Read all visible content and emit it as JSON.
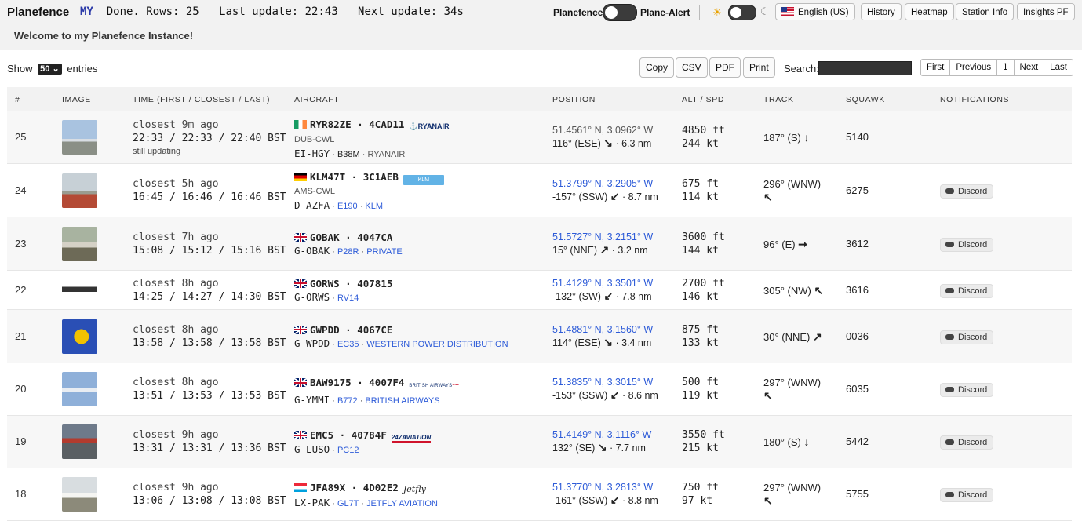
{
  "header": {
    "brand": "Planefence",
    "my": "MY",
    "status": "Done. Rows: 25",
    "last_update": "Last update: 22:43",
    "next_update": "Next update: 34s",
    "welcome": "Welcome to my Planefence Instance!",
    "toggle_left": "Planefence",
    "toggle_right": "Plane-Alert",
    "language": "English (US)",
    "buttons": [
      "History",
      "Heatmap",
      "Station Info",
      "Insights PF"
    ]
  },
  "controls": {
    "show_prefix": "Show",
    "entries_value": "50",
    "show_suffix": "entries",
    "export_buttons": [
      "Copy",
      "CSV",
      "PDF",
      "Print"
    ],
    "search_label": "Search:",
    "pager": [
      "First",
      "Previous",
      "1",
      "Next",
      "Last"
    ]
  },
  "table": {
    "columns": [
      "#",
      "Image",
      "Time (First / Closest / Last)",
      "Aircraft",
      "Position",
      "Alt / Spd",
      "Track",
      "Squawk",
      "Notifications"
    ],
    "rows": [
      {
        "num": "25",
        "closest": "closest 9m ago",
        "times": "22:33 / 22:33 / 22:40 BST",
        "note": "still updating",
        "flag": "ie",
        "callsign": "RYR82ZE",
        "hex": "4CAD11",
        "logo": "RYANAIR",
        "route": "DUB-CWL",
        "reg": "EI-HGY",
        "type": "B38M",
        "operator": "RYANAIR",
        "coords": "51.4561° N, 3.0962° W",
        "bearing": "116° (ESE)",
        "arrow": "↘",
        "dist": "6.3 nm",
        "alt": "4850 ft",
        "spd": "244 kt",
        "track": "187° (S)",
        "track_arrow": "↓",
        "squawk": "5140",
        "notify": ""
      },
      {
        "num": "24",
        "closest": "closest 5h ago",
        "times": "16:45 / 16:46 / 16:46 BST",
        "note": "",
        "flag": "de",
        "callsign": "KLM47T",
        "hex": "3C1AEB",
        "logo": "KLM",
        "route": "AMS-CWL",
        "reg": "D-AZFA",
        "type": "E190",
        "operator": "KLM",
        "coords": "51.3799° N, 3.2905° W",
        "bearing": "-157° (SSW)",
        "arrow": "↙",
        "dist": "8.7 nm",
        "alt": "675 ft",
        "spd": "114 kt",
        "track": "296° (WNW)",
        "track_arrow": "↖",
        "squawk": "6275",
        "notify": "Discord"
      },
      {
        "num": "23",
        "closest": "closest 7h ago",
        "times": "15:08 / 15:12 / 15:16 BST",
        "note": "",
        "flag": "gb",
        "callsign": "GOBAK",
        "hex": "4047CA",
        "logo": "",
        "route": "",
        "reg": "G-OBAK",
        "type": "P28R",
        "operator": "PRIVATE",
        "coords": "51.5727° N, 3.2151° W",
        "bearing": "15° (NNE)",
        "arrow": "↗",
        "dist": "3.2 nm",
        "alt": "3600 ft",
        "spd": "144 kt",
        "track": "96° (E)",
        "track_arrow": "➞",
        "squawk": "3612",
        "notify": "Discord"
      },
      {
        "num": "22",
        "closest": "closest 8h ago",
        "times": "14:25 / 14:27 / 14:30 BST",
        "note": "",
        "flag": "gb",
        "callsign": "GORWS",
        "hex": "407815",
        "logo": "",
        "route": "",
        "reg": "G-ORWS",
        "type": "RV14",
        "operator": "",
        "coords": "51.4129° N, 3.3501° W",
        "bearing": "-132° (SW)",
        "arrow": "↙",
        "dist": "7.8 nm",
        "alt": "2700 ft",
        "spd": "146 kt",
        "track": "305° (NW)",
        "track_arrow": "↖",
        "squawk": "3616",
        "notify": "Discord"
      },
      {
        "num": "21",
        "closest": "closest 8h ago",
        "times": "13:58 / 13:58 / 13:58 BST",
        "note": "",
        "flag": "gb",
        "callsign": "GWPDD",
        "hex": "4067CE",
        "logo": "",
        "route": "",
        "reg": "G-WPDD",
        "type": "EC35",
        "operator": "WESTERN POWER DISTRIBUTION",
        "coords": "51.4881° N, 3.1560° W",
        "bearing": "114° (ESE)",
        "arrow": "↘",
        "dist": "3.4 nm",
        "alt": "875 ft",
        "spd": "133 kt",
        "track": "30° (NNE)",
        "track_arrow": "↗",
        "squawk": "0036",
        "notify": "Discord"
      },
      {
        "num": "20",
        "closest": "closest 8h ago",
        "times": "13:51 / 13:53 / 13:53 BST",
        "note": "",
        "flag": "gb",
        "callsign": "BAW9175",
        "hex": "4007F4",
        "logo": "BRITISH AIRWAYS",
        "route": "",
        "reg": "G-YMMI",
        "type": "B772",
        "operator": "BRITISH AIRWAYS",
        "coords": "51.3835° N, 3.3015° W",
        "bearing": "-153° (SSW)",
        "arrow": "↙",
        "dist": "8.6 nm",
        "alt": "500 ft",
        "spd": "119 kt",
        "track": "297° (WNW)",
        "track_arrow": "↖",
        "squawk": "6035",
        "notify": "Discord"
      },
      {
        "num": "19",
        "closest": "closest 9h ago",
        "times": "13:31 / 13:31 / 13:36 BST",
        "note": "",
        "flag": "gb",
        "callsign": "EMC5",
        "hex": "40784F",
        "logo": "247AVIATION",
        "route": "",
        "reg": "G-LUSO",
        "type": "PC12",
        "operator": "",
        "coords": "51.4149° N, 3.1116° W",
        "bearing": "132° (SE)",
        "arrow": "↘",
        "dist": "7.7 nm",
        "alt": "3550 ft",
        "spd": "215 kt",
        "track": "180° (S)",
        "track_arrow": "↓",
        "squawk": "5442",
        "notify": "Discord"
      },
      {
        "num": "18",
        "closest": "closest 9h ago",
        "times": "13:06 / 13:08 / 13:08 BST",
        "note": "",
        "flag": "lu",
        "callsign": "JFA89X",
        "hex": "4D02E2",
        "logo": "Jetfly",
        "route": "",
        "reg": "LX-PAK",
        "type": "GL7T",
        "operator": "JETFLY AVIATION",
        "coords": "51.3770° N, 3.2813° W",
        "bearing": "-161° (SSW)",
        "arrow": "↙",
        "dist": "8.8 nm",
        "alt": "750 ft",
        "spd": "97 kt",
        "track": "297° (WNW)",
        "track_arrow": "↖",
        "squawk": "5755",
        "notify": "Discord"
      }
    ]
  }
}
